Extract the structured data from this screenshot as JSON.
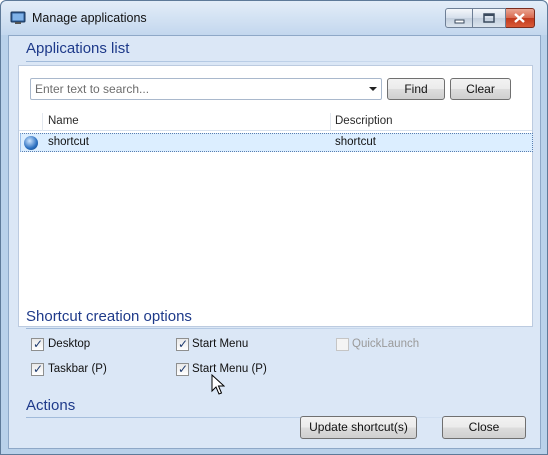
{
  "window": {
    "title": "Manage applications"
  },
  "sections": {
    "applications": "Applications list",
    "shortcut_options": "Shortcut creation options",
    "actions": "Actions"
  },
  "search": {
    "placeholder": "Enter text to search...",
    "value": ""
  },
  "buttons": {
    "find": "Find",
    "clear": "Clear",
    "update": "Update shortcut(s)",
    "close": "Close"
  },
  "table": {
    "columns": [
      "Name",
      "Description"
    ],
    "rows": [
      {
        "name": "shortcut",
        "description": "shortcut",
        "icon": "globe-icon",
        "selected": true
      }
    ]
  },
  "options": {
    "desktop": {
      "label": "Desktop",
      "checked": true,
      "enabled": true
    },
    "start_menu": {
      "label": "Start Menu",
      "checked": true,
      "enabled": true
    },
    "quicklaunch": {
      "label": "QuickLaunch",
      "checked": false,
      "enabled": false
    },
    "taskbar": {
      "label": "Taskbar (P)",
      "checked": true,
      "enabled": true
    },
    "start_menu_p": {
      "label": "Start Menu (P)",
      "checked": true,
      "enabled": true
    }
  },
  "colors": {
    "section_title": "#1e3a8a",
    "client_bg": "#dbe7f6",
    "selection": "#dceeff"
  }
}
